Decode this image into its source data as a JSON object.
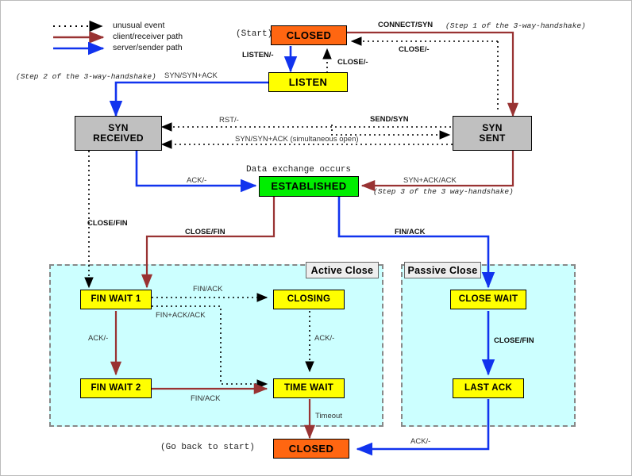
{
  "legend": {
    "items": [
      {
        "id": "unusual",
        "label": "unusual event",
        "color": "#000000",
        "style": "dotted"
      },
      {
        "id": "client",
        "label": "client/receiver path",
        "color": "#993333",
        "style": "solid"
      },
      {
        "id": "server",
        "label": "server/sender path",
        "color": "#1133ee",
        "style": "solid"
      }
    ]
  },
  "states": [
    {
      "id": "closed-top",
      "label": "CLOSED",
      "color": "#ff6611"
    },
    {
      "id": "listen",
      "label": "LISTEN",
      "color": "#ffff00"
    },
    {
      "id": "syn-received",
      "label": "SYN\nRECEIVED",
      "line1": "SYN",
      "line2": "RECEIVED",
      "color": "#c0c0c0"
    },
    {
      "id": "syn-sent",
      "label": "SYN\nSENT",
      "line1": "SYN",
      "line2": "SENT",
      "color": "#c0c0c0"
    },
    {
      "id": "established",
      "label": "ESTABLISHED",
      "color": "#00ee00"
    },
    {
      "id": "fin-wait-1",
      "label": "FIN WAIT 1",
      "color": "#ffff00"
    },
    {
      "id": "closing",
      "label": "CLOSING",
      "color": "#ffff00"
    },
    {
      "id": "fin-wait-2",
      "label": "FIN WAIT 2",
      "color": "#ffff00"
    },
    {
      "id": "time-wait",
      "label": "TIME WAIT",
      "color": "#ffff00"
    },
    {
      "id": "close-wait",
      "label": "CLOSE WAIT",
      "color": "#ffff00"
    },
    {
      "id": "last-ack",
      "label": "LAST ACK",
      "color": "#ffff00"
    },
    {
      "id": "closed-bottom",
      "label": "CLOSED",
      "color": "#ff6611"
    }
  ],
  "groups": [
    {
      "id": "active-close",
      "label": "Active Close"
    },
    {
      "id": "passive-close",
      "label": "Passive Close"
    }
  ],
  "annotations": {
    "start": "(Start)",
    "go_back_to_start": "(Go back to start)",
    "data_exchange": "Data exchange occurs",
    "step1": "(Step 1 of the 3-way-handshake)",
    "step2": "(Step 2 of the 3-way-handshake)",
    "step3": "(Step 3 of the 3 way-handshake)",
    "simultaneous_open": "(simultaneous open)"
  },
  "transitions": {
    "connect_syn": "CONNECT/SYN",
    "listen_none": "LISTEN/-",
    "close_none_top": "CLOSE/-",
    "close_none_right": "CLOSE/-",
    "syn_synack_left": "SYN/SYN+ACK",
    "rst_none": "RST/-",
    "send_syn": "SEND/SYN",
    "syn_synack_sim": "SYN/SYN+ACK",
    "ack_none_estab": "ACK/-",
    "synack_ack": "SYN+ACK/ACK",
    "close_fin_dotted": "CLOSE/FIN",
    "close_fin_red": "CLOSE/FIN",
    "fin_ack_blue": "FIN/ACK",
    "fin_ack_top": "FIN/ACK",
    "fin_ack_ack": "FIN+ACK/ACK",
    "ack_none_fw1": "ACK/-",
    "ack_none_closing": "ACK/-",
    "fin_ack_bottom": "FIN/ACK",
    "close_fin_passive": "CLOSE/FIN",
    "timeout": "Timeout",
    "ack_none_lastack": "ACK/-"
  },
  "colors": {
    "client_path": "#993333",
    "server_path": "#1133ee",
    "unusual_path": "#000000",
    "group_bg": "#ccffff",
    "group_border": "#888888"
  }
}
